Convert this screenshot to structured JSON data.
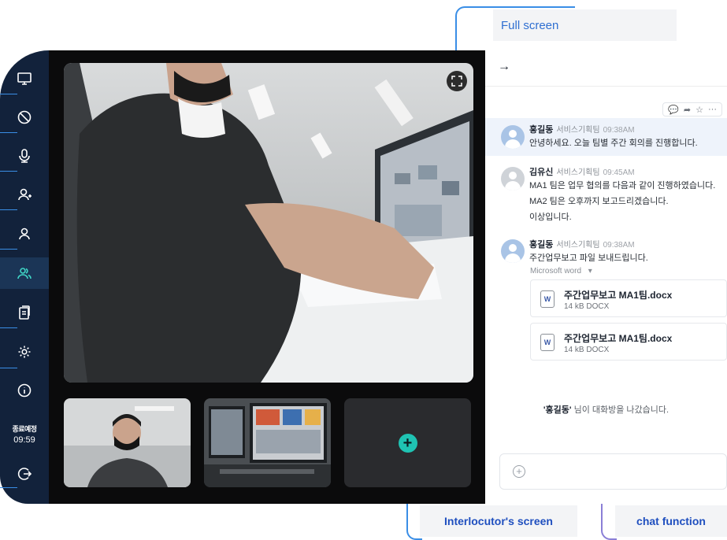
{
  "callouts": {
    "full_screen": "Full screen",
    "interlocutor_screen": "Interlocutor's screen",
    "chat_function": "chat function"
  },
  "sidebar": {
    "items": [
      {
        "icon": "monitor-icon"
      },
      {
        "icon": "block-icon"
      },
      {
        "icon": "microphone-icon"
      },
      {
        "icon": "add-user-icon"
      },
      {
        "icon": "user-icon"
      },
      {
        "icon": "participants-icon",
        "active": true
      },
      {
        "icon": "clipboard-icon"
      },
      {
        "icon": "gear-icon"
      },
      {
        "icon": "info-icon"
      }
    ],
    "timer_label": "종료예정",
    "timer_value": "09:59",
    "exit_icon": "exit-icon"
  },
  "chat": {
    "back_arrow": "→",
    "message_actions": [
      "💬",
      "➦",
      "☆",
      "···"
    ],
    "messages": [
      {
        "name": "홍길동",
        "team": "서비스기획팀",
        "time": "09:38AM",
        "lines": [
          "안녕하세요. 오늘 팀별 주간 회의를 진행합니다."
        ]
      },
      {
        "name": "김유신",
        "team": "서비스기획팀",
        "time": "09:45AM",
        "lines": [
          "MA1 팀은 업무 협의를 다음과 같이 진행하였습니다.",
          "MA2 팀은 오후까지 보고드리겠습니다.",
          "이상입니다."
        ]
      },
      {
        "name": "홍길동",
        "team": "서비스기획팀",
        "time": "09:38AM",
        "lines": [
          "주간업무보고 파일 보내드립니다."
        ]
      }
    ],
    "attachment_group": "Microsoft word",
    "files": [
      {
        "icon_letter": "W",
        "name": "주간업무보고 MA1팀.docx",
        "size": "14 kB DOCX"
      },
      {
        "icon_letter": "W",
        "name": "주간업무보고 MA1팀.docx",
        "size": "14 kB DOCX"
      }
    ],
    "system_name": "'홍길동'",
    "system_text": " 님이 대화방을 나갔습니다.",
    "composer_placeholder": ""
  },
  "colors": {
    "rail": "#12223b",
    "accent": "#3a8ee6",
    "add_button": "#1fc3b3"
  }
}
